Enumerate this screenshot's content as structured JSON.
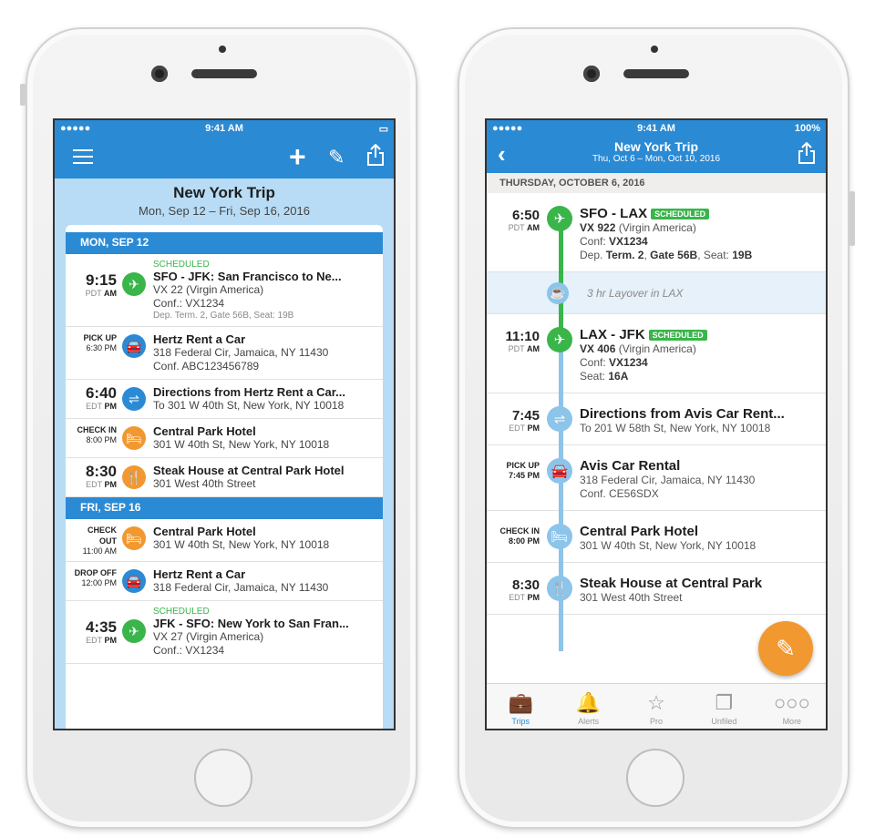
{
  "colors": {
    "brand": "#2b8ad4",
    "green": "#39b54a",
    "orange": "#f29830",
    "flightGreen": "#39b54a",
    "directions": "#2b8ad4",
    "lightBlue": "#8cc4ea"
  },
  "left": {
    "status": {
      "carrier": "●●●●● ",
      "time": "9:41 AM"
    },
    "title": "New York Trip",
    "dates": "Mon, Sep 12 – Fri, Sep 16, 2016",
    "days": [
      {
        "label": "MON, SEP 12",
        "items": [
          {
            "time": "9:15",
            "tz": "PDT",
            "ampm": "AM",
            "scheduled": "SCHEDULED",
            "title": "SFO - JFK: San Francisco to Ne...",
            "sub": [
              "VX 22 (Virgin America)",
              "Conf.: VX1234"
            ],
            "small": "Dep. Term. 2, Gate 56B, Seat: 19B",
            "icon": "airplane-icon",
            "glyph": "✈",
            "color": "#39b54a"
          },
          {
            "label": "PICK UP",
            "ltime": "6:30 PM",
            "title": "Hertz Rent a Car",
            "sub": [
              "318 Federal Cir, Jamaica, NY 11430",
              "Conf. ABC123456789"
            ],
            "icon": "car-icon",
            "glyph": "🚘",
            "color": "#2b8ad4"
          },
          {
            "time": "6:40",
            "tz": "EDT",
            "ampm": "PM",
            "title": "Directions from Hertz Rent a Car...",
            "sub": [
              "To 301 W 40th St, New York, NY 10018"
            ],
            "icon": "signpost-icon",
            "glyph": "⇌",
            "color": "#2b8ad4"
          },
          {
            "label": "CHECK IN",
            "ltime": "8:00 PM",
            "title": "Central Park Hotel",
            "sub": [
              "301 W 40th St, New York, NY 10018"
            ],
            "icon": "bed-icon",
            "glyph": "🛏",
            "color": "#f29830"
          },
          {
            "time": "8:30",
            "tz": "EDT",
            "ampm": "PM",
            "title": "Steak House at Central Park Hotel",
            "sub": [
              "301 West 40th Street"
            ],
            "icon": "restaurant-icon",
            "glyph": "🍴",
            "color": "#f29830"
          }
        ]
      },
      {
        "label": "FRI, SEP 16",
        "items": [
          {
            "label": "CHECK OUT",
            "ltime": "11:00 AM",
            "title": "Central Park Hotel",
            "sub": [
              "301 W 40th St, New York, NY 10018"
            ],
            "icon": "bed-icon",
            "glyph": "🛏",
            "color": "#f29830"
          },
          {
            "label": "DROP OFF",
            "ltime": "12:00 PM",
            "title": "Hertz Rent a Car",
            "sub": [
              "318 Federal Cir, Jamaica, NY 11430"
            ],
            "icon": "car-icon",
            "glyph": "🚘",
            "color": "#2b8ad4"
          },
          {
            "time": "4:35",
            "tz": "EDT",
            "ampm": "PM",
            "scheduled": "SCHEDULED",
            "title": "JFK - SFO: New York to San Fran...",
            "sub": [
              "VX 27 (Virgin America)",
              "Conf.: VX1234"
            ],
            "icon": "airplane-icon",
            "glyph": "✈",
            "color": "#39b54a"
          }
        ]
      }
    ]
  },
  "right": {
    "status": {
      "carrier": "●●●●● ",
      "time": "9:41 AM",
      "battery": "100%"
    },
    "title": "New York Trip",
    "dates": "Thu, Oct 6 – Mon, Oct 10, 2016",
    "date_header": "THURSDAY, OCTOBER 6, 2016",
    "items": [
      {
        "time": "6:50",
        "tz": "PDT",
        "ampm": "AM",
        "title": "SFO - LAX",
        "badge": "SCHEDULED",
        "lines": [
          [
            "",
            "VX 922",
            " (Virgin America)"
          ],
          [
            "Conf: ",
            "VX1234",
            ""
          ],
          [
            "Dep. ",
            "Term. 2",
            ", ",
            "Gate 56B",
            ", Seat: ",
            "19B"
          ]
        ],
        "icon": "airplane-icon",
        "glyph": "✈",
        "color": "#39b54a"
      },
      {
        "layover": "3 hr Layover in LAX",
        "icon": "coffee-icon",
        "glyph": "☕"
      },
      {
        "time": "11:10",
        "tz": "PDT",
        "ampm": "AM",
        "title": "LAX - JFK",
        "badge": "SCHEDULED",
        "lines": [
          [
            "",
            "VX 406",
            " (Virgin America)"
          ],
          [
            "Conf: ",
            "VX1234",
            ""
          ],
          [
            "Seat: ",
            "16A",
            ""
          ]
        ],
        "icon": "airplane-icon",
        "glyph": "✈",
        "color": "#39b54a"
      },
      {
        "time": "7:45",
        "tz": "EDT",
        "ampm": "PM",
        "title": "Directions from Avis Car Rent...",
        "lines": [
          [
            "To 201 W 58th St, New York, NY 10018",
            "",
            ""
          ]
        ],
        "icon": "signpost-icon",
        "glyph": "⇌",
        "color": "#8cc4ea"
      },
      {
        "label": "PICK UP",
        "ltime": "7:45 PM",
        "title": "Avis Car Rental",
        "lines": [
          [
            "318 Federal Cir, Jamaica, NY 11430",
            "",
            ""
          ],
          [
            "Conf. CE56SDX",
            "",
            ""
          ]
        ],
        "icon": "car-icon",
        "glyph": "🚘",
        "color": "#8cc4ea"
      },
      {
        "label": "CHECK IN",
        "ltime": "8:00 PM",
        "title": "Central Park Hotel",
        "lines": [
          [
            "301 W 40th St, New York, NY 10018",
            "",
            ""
          ]
        ],
        "icon": "bed-icon",
        "glyph": "🛏",
        "color": "#8cc4ea"
      },
      {
        "time": "8:30",
        "tz": "EDT",
        "ampm": "PM",
        "title": "Steak House at Central Park",
        "lines": [
          [
            "301 West 40th Street",
            "",
            ""
          ]
        ],
        "icon": "restaurant-icon",
        "glyph": "🍴",
        "color": "#8cc4ea"
      }
    ],
    "tabs": [
      {
        "label": "Trips",
        "icon": "briefcase-icon",
        "glyph": "💼",
        "active": true
      },
      {
        "label": "Alerts",
        "icon": "bell-icon",
        "glyph": "🔔"
      },
      {
        "label": "Pro",
        "icon": "star-icon",
        "glyph": "☆"
      },
      {
        "label": "Unfiled",
        "icon": "documents-icon",
        "glyph": "❐"
      },
      {
        "label": "More",
        "icon": "more-icon",
        "glyph": "○○○"
      }
    ]
  }
}
